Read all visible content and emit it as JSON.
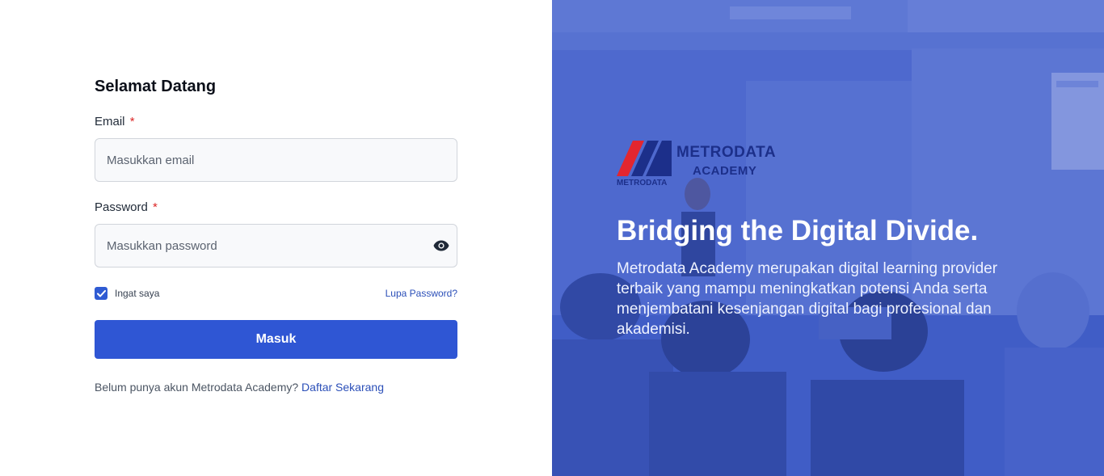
{
  "login": {
    "title": "Selamat Datang",
    "email_label": "Email",
    "email_required": "*",
    "email_placeholder": "Masukkan email",
    "password_label": "Password",
    "password_required": "*",
    "password_placeholder": "Masukkan password",
    "remember_label": "Ingat saya",
    "remember_checked": true,
    "forgot_label": "Lupa Password?",
    "submit_label": "Masuk",
    "register_prompt": "Belum punya akun Metrodata Academy?",
    "register_link": "Daftar Sekarang"
  },
  "hero": {
    "brand_name": "METRODATA",
    "brand_sub": "ACADEMY",
    "brand_small": "METRODATA",
    "headline": "Bridging the Digital Divide.",
    "description": "Metrodata Academy merupakan digital learning provider terbaik yang mampu meningkatkan potensi Anda serta menjembatani kesenjangan digital bagi profesional dan akademisi."
  },
  "colors": {
    "primary": "#2f56d4",
    "link": "#2b4fb8",
    "required": "#dc2626",
    "overlay": "#3755c8",
    "brand_red": "#e3262f",
    "brand_navy": "#1c2f8a"
  },
  "icons": {
    "password_toggle": "eye-icon",
    "remember": "check-icon"
  }
}
